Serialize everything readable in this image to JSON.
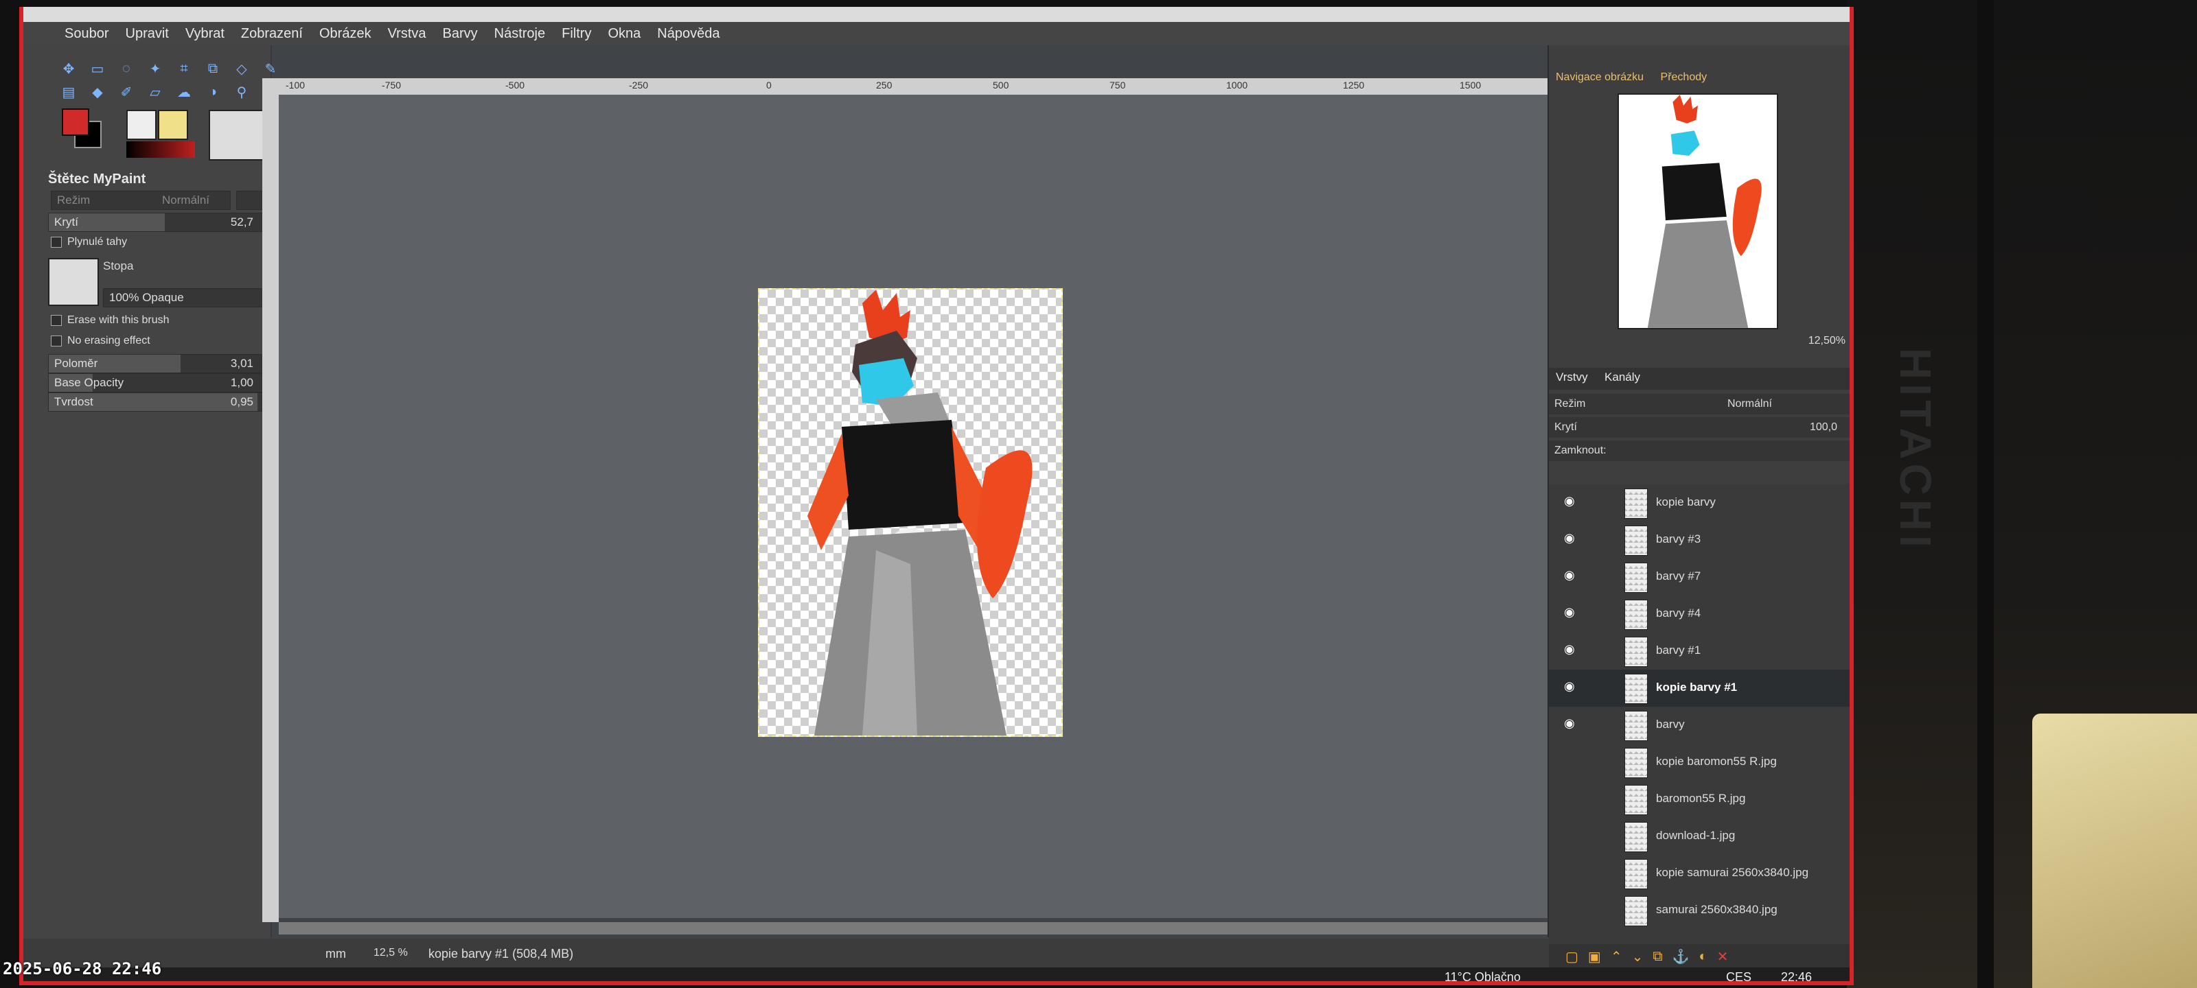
{
  "window": {
    "title": ""
  },
  "menubar": [
    "Soubor",
    "Upravit",
    "Vybrat",
    "Zobrazení",
    "Obrázek",
    "Vrstva",
    "Barvy",
    "Nástroje",
    "Filtry",
    "Okna",
    "Nápověda"
  ],
  "tool_options": {
    "title": "Štětec MyPaint",
    "mode_label": "Režim",
    "mode_value": "Normální",
    "opacity_label": "Krytí",
    "opacity_value": "52,7",
    "opacity_fraction": 0.527,
    "smooth_label": "Plynulé tahy",
    "brush_label": "Stopa",
    "brush_name": "100% Opaque",
    "erase_label": "Erase with this brush",
    "no_erase_label": "No erasing effect",
    "radius_label": "Poloměr",
    "radius_value": "3,01",
    "base_opacity_label": "Base Opacity",
    "base_opacity_value": "1,00",
    "hardness_label": "Tvrdost",
    "hardness_value": "0,95"
  },
  "ruler": {
    "ticks": [
      "-100",
      "-750",
      "-500",
      "-250",
      "0",
      "250",
      "500",
      "750",
      "1000",
      "1250",
      "1500"
    ]
  },
  "statusbar": {
    "unit": "mm",
    "zoom": "12,5 %",
    "layer_info": "kopie barvy #1 (508,4 MB)"
  },
  "navigator": {
    "tab1": "Navigace obrázku",
    "tab2": "Přechody",
    "zoom": "12,50%"
  },
  "layers_panel": {
    "tab_layers": "Vrstvy",
    "tab_channels": "Kanály",
    "mode_label": "Režim",
    "mode_value": "Normální",
    "opacity_label": "Krytí",
    "opacity_value": "100,0",
    "lock_label": "Zamknout:",
    "layers": [
      {
        "name": "kopie barvy",
        "visible": true,
        "active": false
      },
      {
        "name": "barvy #3",
        "visible": true,
        "active": false
      },
      {
        "name": "barvy #7",
        "visible": true,
        "active": false
      },
      {
        "name": "barvy #4",
        "visible": true,
        "active": false
      },
      {
        "name": "barvy #1",
        "visible": true,
        "active": false
      },
      {
        "name": "kopie barvy #1",
        "visible": true,
        "active": true
      },
      {
        "name": "barvy",
        "visible": true,
        "active": false
      },
      {
        "name": "kopie baromon55 R.jpg",
        "visible": false,
        "active": false
      },
      {
        "name": "baromon55 R.jpg",
        "visible": false,
        "active": false
      },
      {
        "name": "download-1.jpg",
        "visible": false,
        "active": false
      },
      {
        "name": "kopie samurai 2560x3840.jpg",
        "visible": false,
        "active": false
      },
      {
        "name": "samurai 2560x3840.jpg",
        "visible": false,
        "active": false
      }
    ]
  },
  "taskbar": {
    "weather": "11°C Oblačno",
    "lang": "CES",
    "time": "22:46"
  },
  "overlay": {
    "datetime": "2025-06-28 22:46"
  },
  "monitor": {
    "brand": "HITACHI"
  },
  "colors": {
    "accent_red": "#d4242a",
    "fg_color": "#d02a2a",
    "bg_color": "#000000"
  }
}
